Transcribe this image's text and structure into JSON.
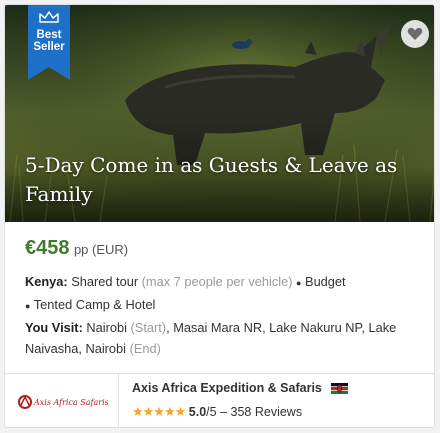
{
  "badge": {
    "line1": "Best",
    "line2": "Seller",
    "icon": "crown-icon",
    "color": "#1e6fc8"
  },
  "favorite": {
    "icon": "heart-icon"
  },
  "tour": {
    "title": "5-Day Come in as Guests & Leave as Family",
    "price": "€458",
    "price_unit": "pp (EUR)",
    "country_label": "Kenya:",
    "tour_type": "Shared tour",
    "capacity_note": "(max 7 people per vehicle)",
    "bullet": "●",
    "budget": "Budget",
    "accommodation": "Tented Camp & Hotel",
    "visit_label": "You Visit:",
    "visit_start": "Nairobi",
    "visit_start_tag": "(Start)",
    "visit_middle": ", Masai Mara NR, Lake Nakuru NP, Lake Naivasha, Nairobi",
    "visit_end_tag": "(End)"
  },
  "operator": {
    "name": "Axis Africa Expedition & Safaris",
    "logo_text": "Axis Africa Safaris",
    "flag": "kenya-flag-icon",
    "stars": "★★★★★",
    "score": "5.0",
    "out_of": "/5",
    "reviews": "358 Reviews",
    "separator": "–"
  },
  "colors": {
    "price": "#3d7c2d",
    "star": "#f4a623",
    "ribbon": "#1e6fc8"
  }
}
